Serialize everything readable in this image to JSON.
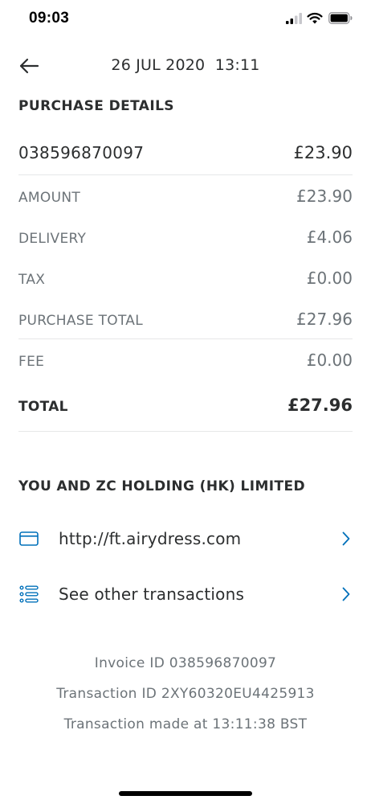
{
  "status_bar": {
    "time": "09:03"
  },
  "header": {
    "datetime": "26 JUL 2020  13:11"
  },
  "purchase_details": {
    "heading": "PURCHASE DETAILS",
    "order": {
      "id": "038596870097",
      "amount": "£23.90"
    },
    "rows": [
      {
        "label": "AMOUNT",
        "value": "£23.90"
      },
      {
        "label": "DELIVERY",
        "value": "£4.06"
      },
      {
        "label": "TAX",
        "value": "£0.00"
      },
      {
        "label": "PURCHASE TOTAL",
        "value": "£27.96"
      },
      {
        "label": "FEE",
        "value": "£0.00"
      }
    ],
    "total": {
      "label": "TOTAL",
      "value": "£27.96"
    }
  },
  "merchant": {
    "heading": "YOU AND ZC HOLDING (HK) LIMITED",
    "website": "http://ft.airydress.com",
    "other_transactions": "See other transactions"
  },
  "footer": {
    "invoice": "Invoice ID 038596870097",
    "transaction": "Transaction ID 2XY60320EU4425913",
    "made_at": "Transaction made at 13:11:38 BST"
  },
  "colors": {
    "accent": "#0070ba",
    "text_primary": "#2c2e2f",
    "text_secondary": "#6c7378",
    "divider": "#e6e7e8"
  },
  "icons": {
    "back": "arrow-left-icon",
    "website": "browser-window-icon",
    "transactions": "list-icon",
    "chevron": "chevron-right-icon"
  }
}
